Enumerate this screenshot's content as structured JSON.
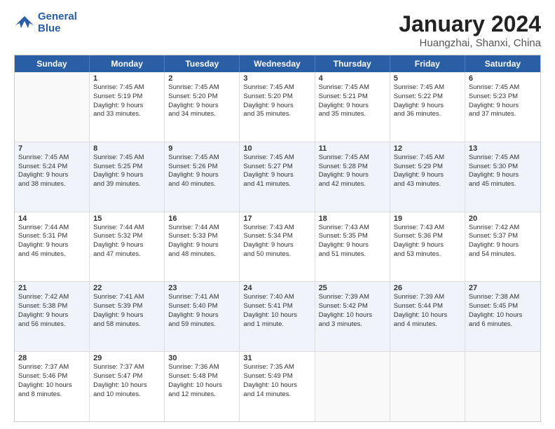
{
  "header": {
    "logo_line1": "General",
    "logo_line2": "Blue",
    "title": "January 2024",
    "subtitle": "Huangzhai, Shanxi, China"
  },
  "weekdays": [
    "Sunday",
    "Monday",
    "Tuesday",
    "Wednesday",
    "Thursday",
    "Friday",
    "Saturday"
  ],
  "rows": [
    [
      {
        "day": "",
        "info": ""
      },
      {
        "day": "1",
        "info": "Sunrise: 7:45 AM\nSunset: 5:19 PM\nDaylight: 9 hours\nand 33 minutes."
      },
      {
        "day": "2",
        "info": "Sunrise: 7:45 AM\nSunset: 5:20 PM\nDaylight: 9 hours\nand 34 minutes."
      },
      {
        "day": "3",
        "info": "Sunrise: 7:45 AM\nSunset: 5:20 PM\nDaylight: 9 hours\nand 35 minutes."
      },
      {
        "day": "4",
        "info": "Sunrise: 7:45 AM\nSunset: 5:21 PM\nDaylight: 9 hours\nand 35 minutes."
      },
      {
        "day": "5",
        "info": "Sunrise: 7:45 AM\nSunset: 5:22 PM\nDaylight: 9 hours\nand 36 minutes."
      },
      {
        "day": "6",
        "info": "Sunrise: 7:45 AM\nSunset: 5:23 PM\nDaylight: 9 hours\nand 37 minutes."
      }
    ],
    [
      {
        "day": "7",
        "info": "Sunrise: 7:45 AM\nSunset: 5:24 PM\nDaylight: 9 hours\nand 38 minutes."
      },
      {
        "day": "8",
        "info": "Sunrise: 7:45 AM\nSunset: 5:25 PM\nDaylight: 9 hours\nand 39 minutes."
      },
      {
        "day": "9",
        "info": "Sunrise: 7:45 AM\nSunset: 5:26 PM\nDaylight: 9 hours\nand 40 minutes."
      },
      {
        "day": "10",
        "info": "Sunrise: 7:45 AM\nSunset: 5:27 PM\nDaylight: 9 hours\nand 41 minutes."
      },
      {
        "day": "11",
        "info": "Sunrise: 7:45 AM\nSunset: 5:28 PM\nDaylight: 9 hours\nand 42 minutes."
      },
      {
        "day": "12",
        "info": "Sunrise: 7:45 AM\nSunset: 5:29 PM\nDaylight: 9 hours\nand 43 minutes."
      },
      {
        "day": "13",
        "info": "Sunrise: 7:45 AM\nSunset: 5:30 PM\nDaylight: 9 hours\nand 45 minutes."
      }
    ],
    [
      {
        "day": "14",
        "info": "Sunrise: 7:44 AM\nSunset: 5:31 PM\nDaylight: 9 hours\nand 46 minutes."
      },
      {
        "day": "15",
        "info": "Sunrise: 7:44 AM\nSunset: 5:32 PM\nDaylight: 9 hours\nand 47 minutes."
      },
      {
        "day": "16",
        "info": "Sunrise: 7:44 AM\nSunset: 5:33 PM\nDaylight: 9 hours\nand 48 minutes."
      },
      {
        "day": "17",
        "info": "Sunrise: 7:43 AM\nSunset: 5:34 PM\nDaylight: 9 hours\nand 50 minutes."
      },
      {
        "day": "18",
        "info": "Sunrise: 7:43 AM\nSunset: 5:35 PM\nDaylight: 9 hours\nand 51 minutes."
      },
      {
        "day": "19",
        "info": "Sunrise: 7:43 AM\nSunset: 5:36 PM\nDaylight: 9 hours\nand 53 minutes."
      },
      {
        "day": "20",
        "info": "Sunrise: 7:42 AM\nSunset: 5:37 PM\nDaylight: 9 hours\nand 54 minutes."
      }
    ],
    [
      {
        "day": "21",
        "info": "Sunrise: 7:42 AM\nSunset: 5:38 PM\nDaylight: 9 hours\nand 56 minutes."
      },
      {
        "day": "22",
        "info": "Sunrise: 7:41 AM\nSunset: 5:39 PM\nDaylight: 9 hours\nand 58 minutes."
      },
      {
        "day": "23",
        "info": "Sunrise: 7:41 AM\nSunset: 5:40 PM\nDaylight: 9 hours\nand 59 minutes."
      },
      {
        "day": "24",
        "info": "Sunrise: 7:40 AM\nSunset: 5:41 PM\nDaylight: 10 hours\nand 1 minute."
      },
      {
        "day": "25",
        "info": "Sunrise: 7:39 AM\nSunset: 5:42 PM\nDaylight: 10 hours\nand 3 minutes."
      },
      {
        "day": "26",
        "info": "Sunrise: 7:39 AM\nSunset: 5:44 PM\nDaylight: 10 hours\nand 4 minutes."
      },
      {
        "day": "27",
        "info": "Sunrise: 7:38 AM\nSunset: 5:45 PM\nDaylight: 10 hours\nand 6 minutes."
      }
    ],
    [
      {
        "day": "28",
        "info": "Sunrise: 7:37 AM\nSunset: 5:46 PM\nDaylight: 10 hours\nand 8 minutes."
      },
      {
        "day": "29",
        "info": "Sunrise: 7:37 AM\nSunset: 5:47 PM\nDaylight: 10 hours\nand 10 minutes."
      },
      {
        "day": "30",
        "info": "Sunrise: 7:36 AM\nSunset: 5:48 PM\nDaylight: 10 hours\nand 12 minutes."
      },
      {
        "day": "31",
        "info": "Sunrise: 7:35 AM\nSunset: 5:49 PM\nDaylight: 10 hours\nand 14 minutes."
      },
      {
        "day": "",
        "info": ""
      },
      {
        "day": "",
        "info": ""
      },
      {
        "day": "",
        "info": ""
      }
    ]
  ]
}
